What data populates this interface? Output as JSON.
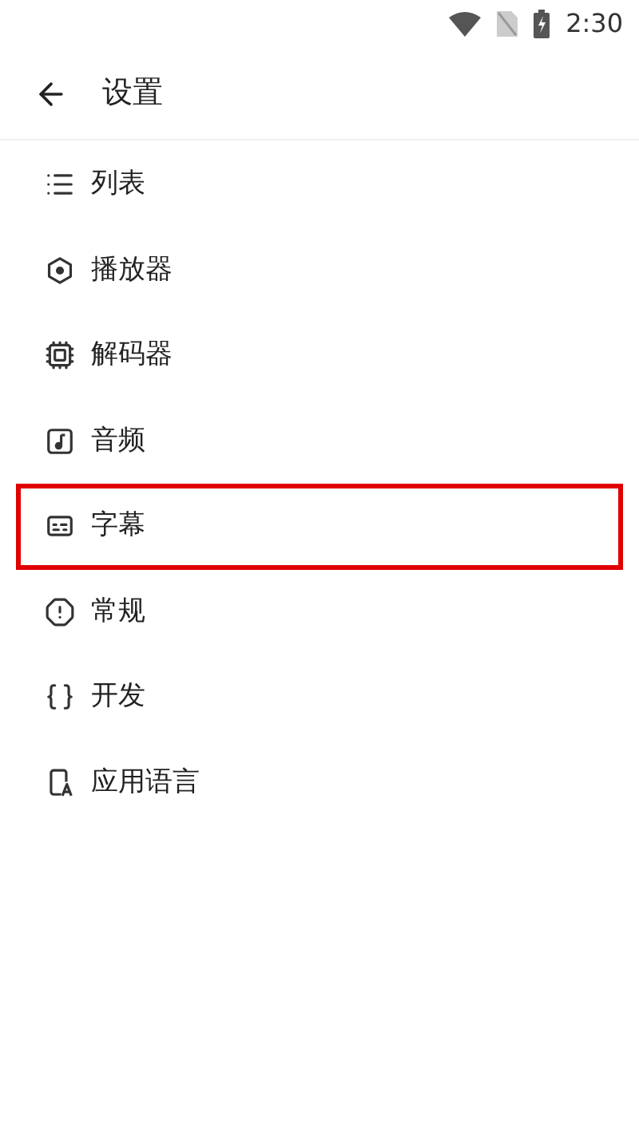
{
  "status_bar": {
    "time": "2:30"
  },
  "header": {
    "title": "设置"
  },
  "items": [
    {
      "label": "列表",
      "highlighted": false
    },
    {
      "label": "播放器",
      "highlighted": false
    },
    {
      "label": "解码器",
      "highlighted": false
    },
    {
      "label": "音频",
      "highlighted": false
    },
    {
      "label": "字幕",
      "highlighted": true
    },
    {
      "label": "常规",
      "highlighted": false
    },
    {
      "label": "开发",
      "highlighted": false
    },
    {
      "label": "应用语言",
      "highlighted": false
    }
  ]
}
